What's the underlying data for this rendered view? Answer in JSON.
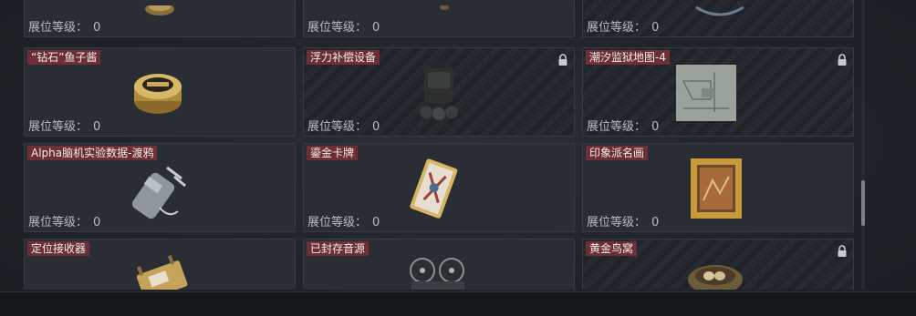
{
  "level_label": "展位等级：",
  "items": [
    {
      "name": "",
      "level": "0",
      "locked": false,
      "icon": "gold-coin-icon"
    },
    {
      "name": "",
      "level": "0",
      "locked": false,
      "icon": "item-icon"
    },
    {
      "name": "",
      "level": "0",
      "locked": false,
      "icon": "item-icon"
    },
    {
      "name": "“钻石”鱼子酱",
      "level": "0",
      "locked": false,
      "icon": "caviar-tin-icon"
    },
    {
      "name": "浮力补偿设备",
      "level": "0",
      "locked": true,
      "icon": "buoyancy-device-icon"
    },
    {
      "name": "潮汐监狱地图-4",
      "level": "0",
      "locked": true,
      "icon": "map-icon"
    },
    {
      "name": "Alpha脑机实验数据-渡鸦",
      "level": "0",
      "locked": false,
      "icon": "data-drive-icon"
    },
    {
      "name": "鎏金卡牌",
      "level": "0",
      "locked": false,
      "icon": "gilded-card-icon"
    },
    {
      "name": "印象派名画",
      "level": "0",
      "locked": false,
      "icon": "framed-painting-icon"
    },
    {
      "name": "定位接收器",
      "level": "",
      "locked": false,
      "icon": "receiver-icon"
    },
    {
      "name": "已封存音源",
      "level": "",
      "locked": false,
      "icon": "reel-recorder-icon"
    },
    {
      "name": "黄金鸟窝",
      "level": "",
      "locked": true,
      "icon": "bird-nest-icon"
    }
  ],
  "colors": {
    "label_bg": "#6b2f35",
    "cell_bg": "#2a2e34",
    "text": "#b8bcc2"
  }
}
